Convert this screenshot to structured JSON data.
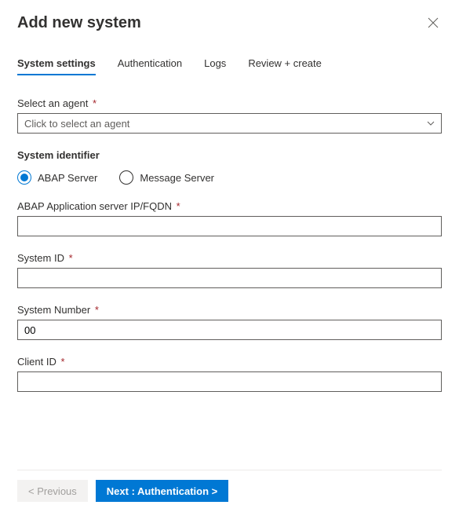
{
  "header": {
    "title": "Add new system"
  },
  "tabs": {
    "system_settings": "System settings",
    "authentication": "Authentication",
    "logs": "Logs",
    "review_create": "Review + create"
  },
  "form": {
    "select_agent": {
      "label": "Select an agent",
      "placeholder": "Click to select an agent",
      "required": "*"
    },
    "system_identifier": {
      "section_label": "System identifier",
      "abap_server": "ABAP Server",
      "message_server": "Message Server"
    },
    "abap_ip": {
      "label": "ABAP Application server IP/FQDN",
      "required": "*",
      "value": ""
    },
    "system_id": {
      "label": "System ID",
      "required": "*",
      "value": ""
    },
    "system_number": {
      "label": "System Number",
      "required": "*",
      "value": "00"
    },
    "client_id": {
      "label": "Client ID",
      "required": "*",
      "value": ""
    }
  },
  "footer": {
    "previous": "< Previous",
    "next": "Next : Authentication >"
  }
}
